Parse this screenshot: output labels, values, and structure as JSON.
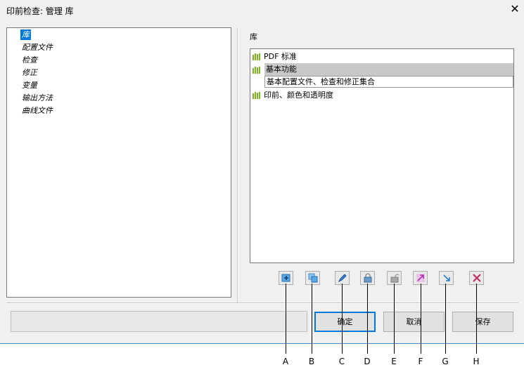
{
  "window": {
    "title": "印前检查: 管理 库",
    "close_glyph": "✕"
  },
  "tree": {
    "items": [
      {
        "label": "库",
        "selected": true
      },
      {
        "label": "配置文件"
      },
      {
        "label": "检查"
      },
      {
        "label": "修正"
      },
      {
        "label": "变量"
      },
      {
        "label": "输出方法"
      },
      {
        "label": "曲线文件"
      }
    ]
  },
  "library": {
    "heading": "库",
    "items": [
      {
        "label": "PDF 标准",
        "icon": "library-bars-icon"
      },
      {
        "label": "基本功能",
        "icon": "library-bars-icon",
        "selected": true,
        "description": "基本配置文件、检查和修正集合"
      },
      {
        "label": "印前、颜色和透明度",
        "icon": "library-bars-icon"
      }
    ],
    "icon_color": "#7ab51d"
  },
  "toolbar": {
    "buttons": [
      {
        "icon": "new-icon"
      },
      {
        "icon": "duplicate-icon"
      },
      {
        "icon": "edit-icon"
      },
      {
        "icon": "lock-icon"
      },
      {
        "icon": "unlock-icon"
      },
      {
        "icon": "import-icon"
      },
      {
        "icon": "export-icon"
      },
      {
        "icon": "delete-icon"
      }
    ]
  },
  "footer": {
    "ok": "确定",
    "cancel": "取消",
    "save": "保存"
  },
  "callouts": [
    "A",
    "B",
    "C",
    "D",
    "E",
    "F",
    "G",
    "H"
  ],
  "colors": {
    "selection": "#0078d7",
    "selected_row": "#c8c8c8",
    "accent_line": "#3c8dc5"
  }
}
